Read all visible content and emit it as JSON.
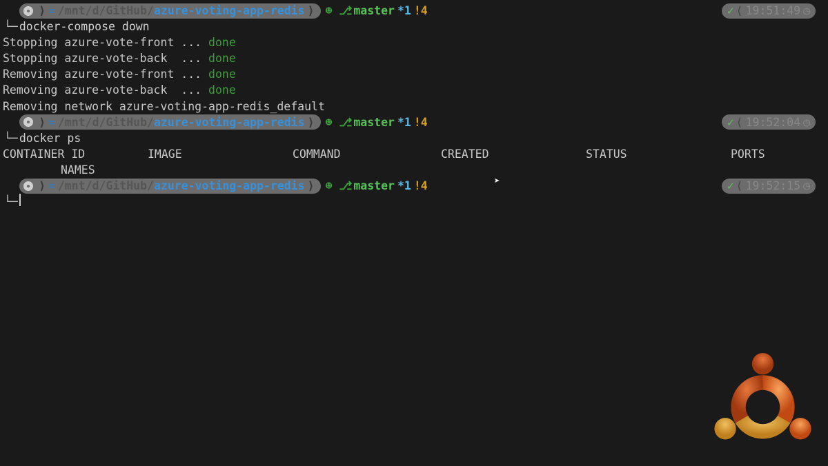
{
  "path": {
    "mnt": "/mnt",
    "sep1": "/",
    "d": "d",
    "sep2": "/",
    "github": "GitHub",
    "sep3": "/",
    "repo": "azure-voting-app-redis"
  },
  "branch": {
    "icon": "☻ ⎇",
    "name": "master",
    "star": "*1",
    "bang": "!4"
  },
  "times": {
    "t1": "19:51:49",
    "t2": "19:52:04",
    "t3": "19:52:15"
  },
  "cmds": {
    "c1": "docker-compose down",
    "c2": "docker ps"
  },
  "output": {
    "l1a": "Stopping azure-vote-front ... ",
    "l1b": "done",
    "l2a": "Stopping azure-vote-back  ... ",
    "l2b": "done",
    "l3a": "Removing azure-vote-front ... ",
    "l3b": "done",
    "l4a": "Removing azure-vote-back  ... ",
    "l4b": "done",
    "l5": "Removing network azure-voting-app-redis_default"
  },
  "headers": {
    "cid": "CONTAINER ID",
    "img": "IMAGE",
    "cmd": "COMMAND",
    "created": "CREATED",
    "status": "STATUS",
    "ports": "PORTS",
    "names": "NAMES"
  },
  "symbols": {
    "check": "✓",
    "chev": "⟨",
    "clock": "◷",
    "right": "⟩",
    "tilde": "≈"
  }
}
